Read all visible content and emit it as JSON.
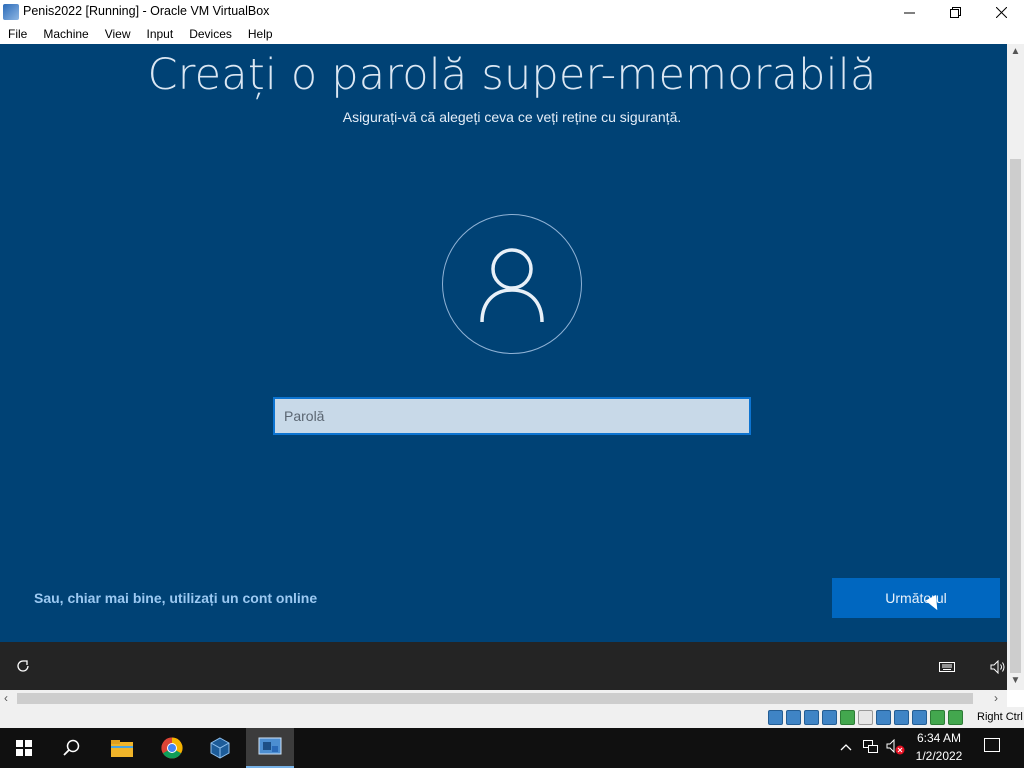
{
  "window": {
    "title": "Penis2022 [Running] - Oracle VM VirtualBox",
    "minimize_glyph": "—",
    "maximize_glyph": "❐",
    "close_glyph": "✕"
  },
  "menu": {
    "items": [
      "File",
      "Machine",
      "View",
      "Input",
      "Devices",
      "Help"
    ]
  },
  "oobe": {
    "heading": "Creați o parolă super-memorabilă",
    "subheading": "Asigurați-vă că alegeți ceva ce veți reține cu siguranță.",
    "password_placeholder": "Parolă",
    "password_value": "",
    "online_account_link": "Sau, chiar mai bine, utilizați un cont online",
    "next_button": "Următorul",
    "colors": {
      "background": "#004275",
      "button": "#0067c0",
      "link": "#9cc9f2",
      "bottom_bar": "#242424"
    }
  },
  "status_bar": {
    "host_key": "Right Ctrl",
    "icons": [
      "hard-disk-icon",
      "optical-drive-icon",
      "audio-icon",
      "network-icon",
      "usb-icon",
      "shared-folders-icon",
      "display-icon",
      "video-capture-icon",
      "mouse-integration-icon",
      "guest-additions-icon",
      "cpu-icon"
    ]
  },
  "taskbar": {
    "time": "6:34 AM",
    "date": "1/2/2022",
    "pinned": [
      "start-icon",
      "search-icon",
      "file-explorer-icon",
      "chrome-icon",
      "virtualbox-icon",
      "virtualbox-manager-icon"
    ]
  }
}
